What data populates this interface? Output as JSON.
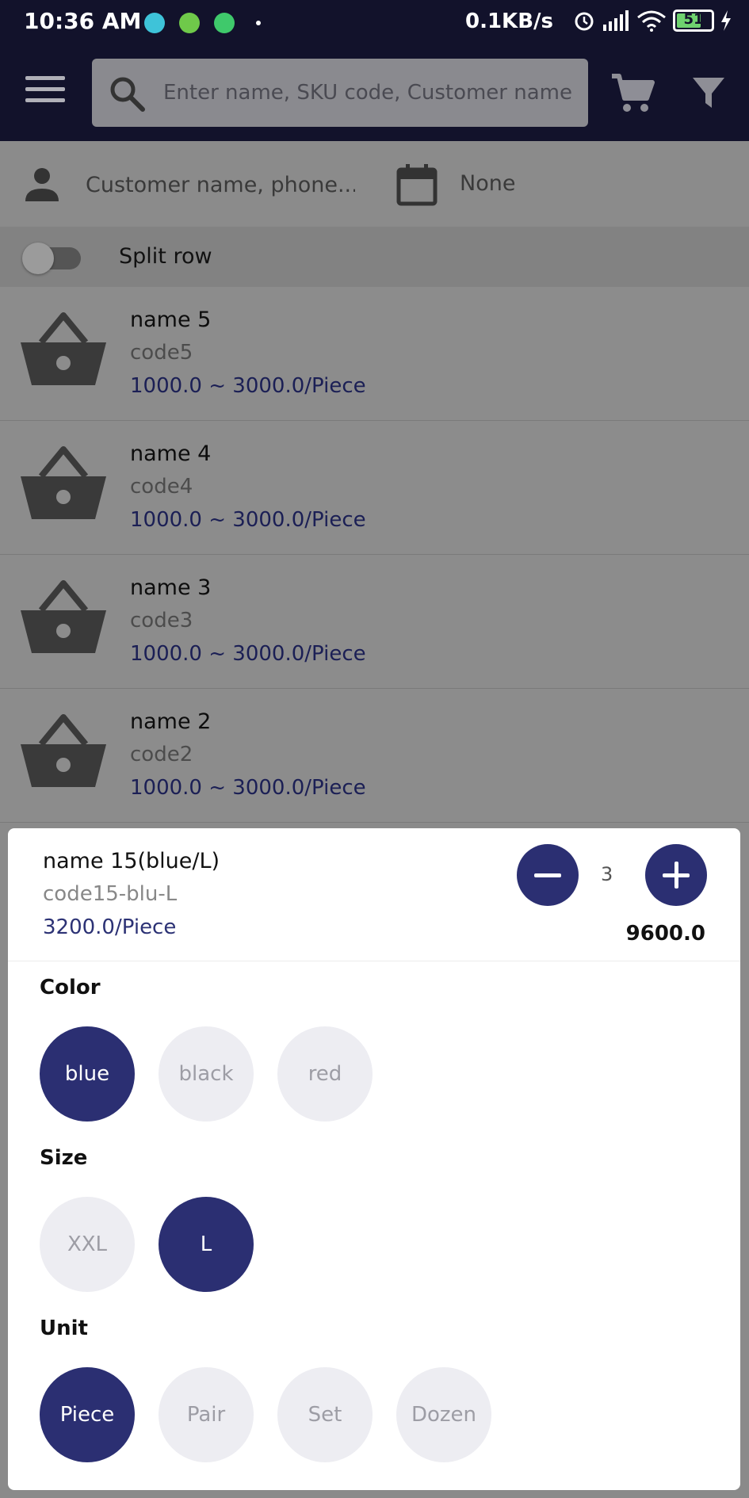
{
  "status_bar": {
    "time": "10:36 AM",
    "net_speed": "0.1KB/s",
    "battery_level": "51",
    "notification_icons": [
      "browser-icon",
      "shield-app-icon",
      "android-app-icon"
    ]
  },
  "top_bar": {
    "search_placeholder": "Enter name, SKU code, Customer name"
  },
  "customer_bar": {
    "placeholder": "Customer name, phone...",
    "date_value": "None"
  },
  "split_row": {
    "label": "Split row",
    "enabled": false
  },
  "products": [
    {
      "name": "name 5",
      "code": "code5",
      "price": "1000.0 ~ 3000.0/Piece"
    },
    {
      "name": "name 4",
      "code": "code4",
      "price": "1000.0 ~ 3000.0/Piece"
    },
    {
      "name": "name 3",
      "code": "code3",
      "price": "1000.0 ~ 3000.0/Piece"
    },
    {
      "name": "name 2",
      "code": "code2",
      "price": "1000.0 ~ 3000.0/Piece"
    }
  ],
  "selection": {
    "name": "name 15(blue/L)",
    "code": "code15-blu-L",
    "price": "3200.0/Piece",
    "quantity": "3",
    "total": "9600.0",
    "groups": [
      {
        "label": "Color",
        "options": [
          "blue",
          "black",
          "red"
        ],
        "selected": "blue"
      },
      {
        "label": "Size",
        "options": [
          "XXL",
          "L"
        ],
        "selected": "L"
      },
      {
        "label": "Unit",
        "options": [
          "Piece",
          "Pair",
          "Set",
          "Dozen"
        ],
        "selected": "Piece"
      }
    ]
  },
  "colors": {
    "header_bg": "#12122b",
    "accent": "#2b2f72",
    "chip_inactive": "#ededf2"
  }
}
